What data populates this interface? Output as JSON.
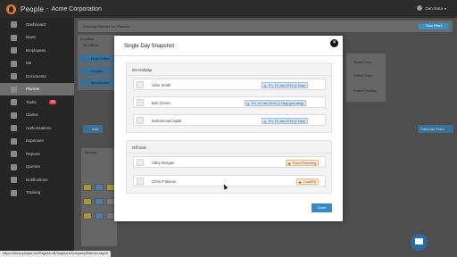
{
  "app": {
    "name": "People",
    "separator": "-",
    "company": "Acme Corporation",
    "user": "Dan Muta"
  },
  "sidebar": {
    "items": [
      {
        "label": "Dashboard",
        "icon": "dashboard-icon"
      },
      {
        "label": "News",
        "icon": "news-icon"
      },
      {
        "label": "Employees",
        "icon": "employees-icon"
      },
      {
        "label": "Me",
        "icon": "me-icon"
      },
      {
        "label": "Documents",
        "icon": "documents-icon"
      },
      {
        "label": "Planner",
        "icon": "planner-icon"
      },
      {
        "label": "Tasks",
        "icon": "tasks-icon",
        "badge": "28"
      },
      {
        "label": "Claims",
        "icon": "claims-icon"
      },
      {
        "label": "Authorisations",
        "icon": "authorisations-icon"
      },
      {
        "label": "Expenses",
        "icon": "expenses-icon"
      },
      {
        "label": "Reports",
        "icon": "reports-icon"
      },
      {
        "label": "Queries",
        "icon": "queries-icon"
      },
      {
        "label": "Notifications",
        "icon": "notifications-icon"
      },
      {
        "label": "Training",
        "icon": "training-icon"
      }
    ],
    "active_index": 5
  },
  "background": {
    "header_text": "Showing Planner for: Planner",
    "header_button": "Clear Filters",
    "filter_label": "Location",
    "filter_value": "All Offices",
    "office_items": [
      "Head Office",
      "London",
      "Manchester"
    ],
    "right_list": [
      "Select Line",
      "Check Point",
      "Parent Section"
    ],
    "add_button": "Add",
    "calendar_button": "Calendar Feed",
    "month": "January"
  },
  "modal": {
    "title": "Single Day Snapshot",
    "close_icon": "close-icon",
    "close_button": "Close",
    "groups": [
      {
        "title": "On Holiday",
        "rows": [
          {
            "name": "John Smith",
            "tag": "Fri, 15 Jan 2016 (1 Day)",
            "tag_icon": "plane-icon"
          },
          {
            "name": "Bob Green",
            "tag": "Fri, 15 Jan 2016 (1 Day) (pending)",
            "tag_icon": "plane-icon"
          },
          {
            "name": "Mohammad Iqbal",
            "tag": "Fri, 15 Jan 2016 (1 Day)",
            "tag_icon": "plane-icon"
          }
        ]
      },
      {
        "title": "Off Sick",
        "rows": [
          {
            "name": "Abby Morgan",
            "tag": "Food Poisoning",
            "tag_icon": "medical-icon"
          },
          {
            "name": "Chris P Bacon",
            "tag": "Cold/Flu",
            "tag_icon": "medical-icon"
          }
        ]
      }
    ]
  },
  "status_url": "https://demo.people.net/Pages/LoB/Segment/Company/Planner.aspx#",
  "colors": {
    "accent": "#3b87c4",
    "logo": "#e8792b",
    "badge": "#e04040",
    "holiday_tag": "#dbe8f4",
    "sick_tag": "#fbe8d6"
  }
}
